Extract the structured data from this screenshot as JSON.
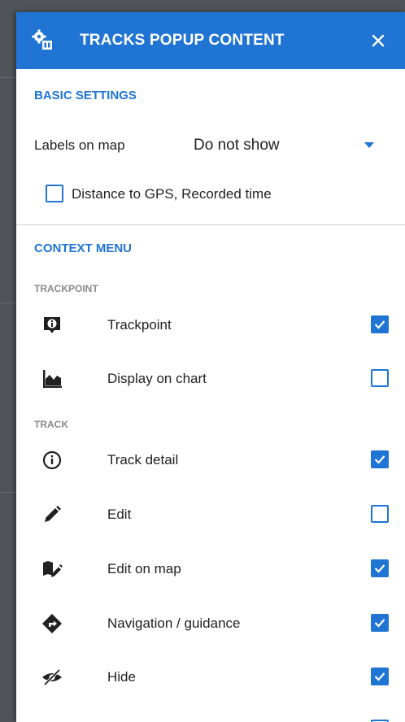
{
  "dialog": {
    "title": "TRACKS POPUP CONTENT",
    "settings_icon": "settings-icon",
    "close_icon": "close-icon"
  },
  "basic_settings": {
    "title": "BASIC SETTINGS",
    "labels_on_map": {
      "label": "Labels on map",
      "value": "Do not show"
    },
    "distance_option": {
      "label": "Distance to GPS, Recorded time",
      "checked": false
    }
  },
  "context_menu": {
    "title": "CONTEXT MENU",
    "groups": [
      {
        "header": "TRACKPOINT",
        "items": [
          {
            "label": "Trackpoint",
            "icon": "trackpoint-icon",
            "checked": true
          },
          {
            "label": "Display on chart",
            "icon": "chart-icon",
            "checked": false
          }
        ]
      },
      {
        "header": "TRACK",
        "items": [
          {
            "label": "Track detail",
            "icon": "info-icon",
            "checked": true
          },
          {
            "label": "Edit",
            "icon": "pencil-icon",
            "checked": false
          },
          {
            "label": "Edit on map",
            "icon": "map-edit-icon",
            "checked": true
          },
          {
            "label": "Navigation / guidance",
            "icon": "navigation-icon",
            "checked": true
          },
          {
            "label": "Hide",
            "icon": "eye-off-icon",
            "checked": true
          }
        ]
      }
    ]
  },
  "colors": {
    "accent": "#1f74d4",
    "header_bg": "#1f74d4",
    "subheader_text": "#8a8a8a"
  }
}
